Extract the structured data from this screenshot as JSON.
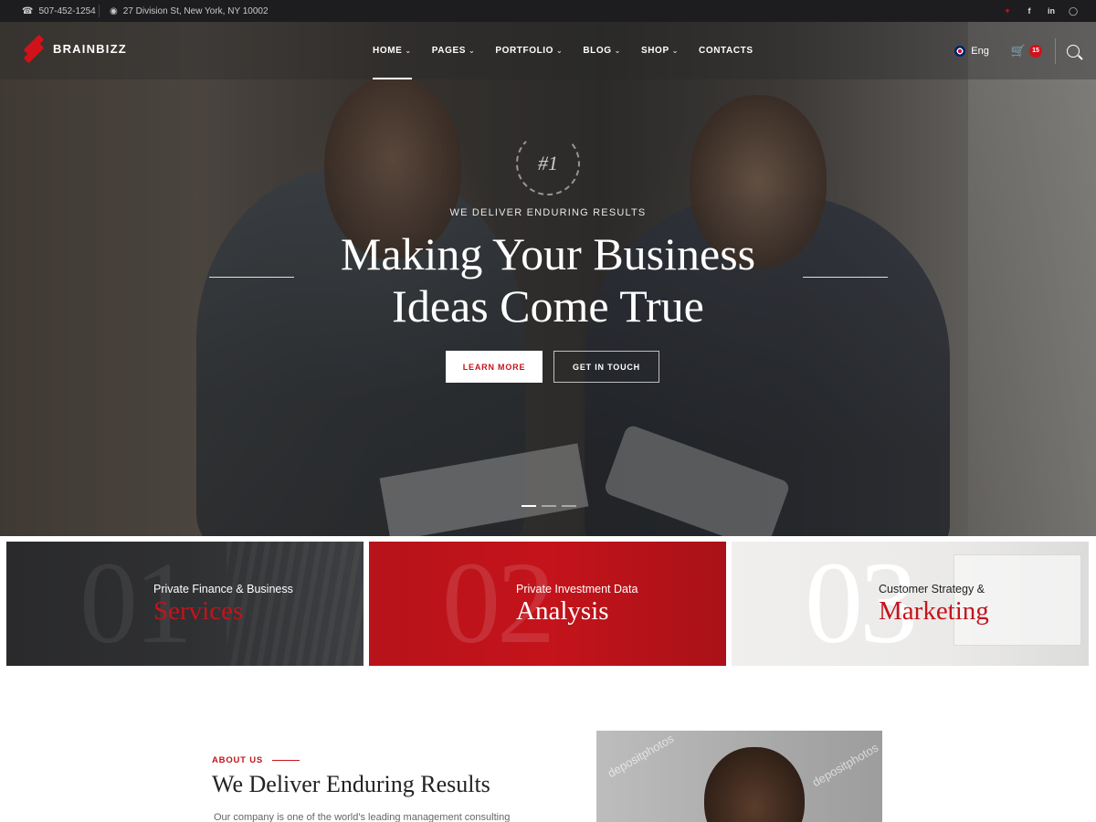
{
  "topbar": {
    "phone": "507-452-1254",
    "address": "27 Division St, New York, NY 10002",
    "socials": [
      "twitter-icon",
      "facebook-icon",
      "linkedin-icon",
      "instagram-icon"
    ]
  },
  "brand": {
    "name": "BRAINBIZZ",
    "accent": "#d0121b"
  },
  "nav": {
    "items": [
      {
        "label": "HOME"
      },
      {
        "label": "PAGES"
      },
      {
        "label": "PORTFOLIO"
      },
      {
        "label": "BLOG"
      },
      {
        "label": "SHOP"
      },
      {
        "label": "CONTACTS"
      }
    ],
    "language": "Eng",
    "cart_count": "15"
  },
  "hero": {
    "badge": "#1",
    "eyebrow": "WE DELIVER ENDURING RESULTS",
    "title_line1": "Making Your Business",
    "title_line2": "Ideas Come True",
    "learn_more": "LEARN MORE",
    "get_in_touch": "GET IN TOUCH",
    "slides_total": 3,
    "active_slide": 1
  },
  "cards": [
    {
      "number": "01",
      "small": "Private Finance & Business",
      "big": "Services"
    },
    {
      "number": "02",
      "small": "Private Investment Data",
      "big": "Analysis"
    },
    {
      "number": "03",
      "small": "Customer Strategy &",
      "big": "Marketing"
    }
  ],
  "about": {
    "label": "ABOUT US",
    "title": "We Deliver Enduring Results",
    "text": "Our company is one of the world's leading management consulting",
    "watermark": "depositphotos"
  }
}
